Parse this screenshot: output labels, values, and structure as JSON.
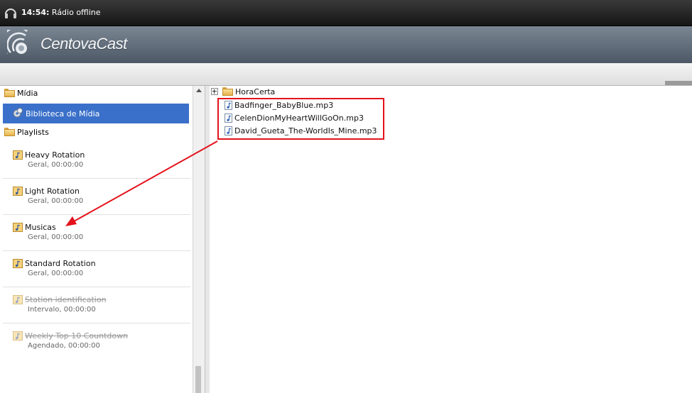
{
  "topbar": {
    "time": "14:54:",
    "status": " Rádio offline"
  },
  "header": {
    "brand": "CentovaCast"
  },
  "sidebar": {
    "media_section": "Mídia",
    "library_item": "Biblioteca de Mídia",
    "playlists_section": "Playlists",
    "playlists": [
      {
        "name": "Heavy Rotation",
        "meta": "Geral, 00:00:00",
        "disabled": false
      },
      {
        "name": "Light Rotation",
        "meta": "Geral, 00:00:00",
        "disabled": false
      },
      {
        "name": "Musicas",
        "meta": "Geral, 00:00:00",
        "disabled": false
      },
      {
        "name": "Standard Rotation",
        "meta": "Geral, 00:00:00",
        "disabled": false
      },
      {
        "name": "Station identification",
        "meta": "Intervalo, 00:00:00",
        "disabled": true
      },
      {
        "name": "Weekly Top 10 Countdown",
        "meta": "Agendado, 00:00:00",
        "disabled": true
      }
    ]
  },
  "files": {
    "folder": "HoraCerta",
    "items": [
      "Badfinger_BabyBlue.mp3",
      "CelenDionMyHeartWillGoOn.mp3",
      "David_Gueta_The-WorldIs_Mine.mp3"
    ]
  },
  "colors": {
    "selection": "#3a70c9",
    "annotation": "#e3121c"
  }
}
